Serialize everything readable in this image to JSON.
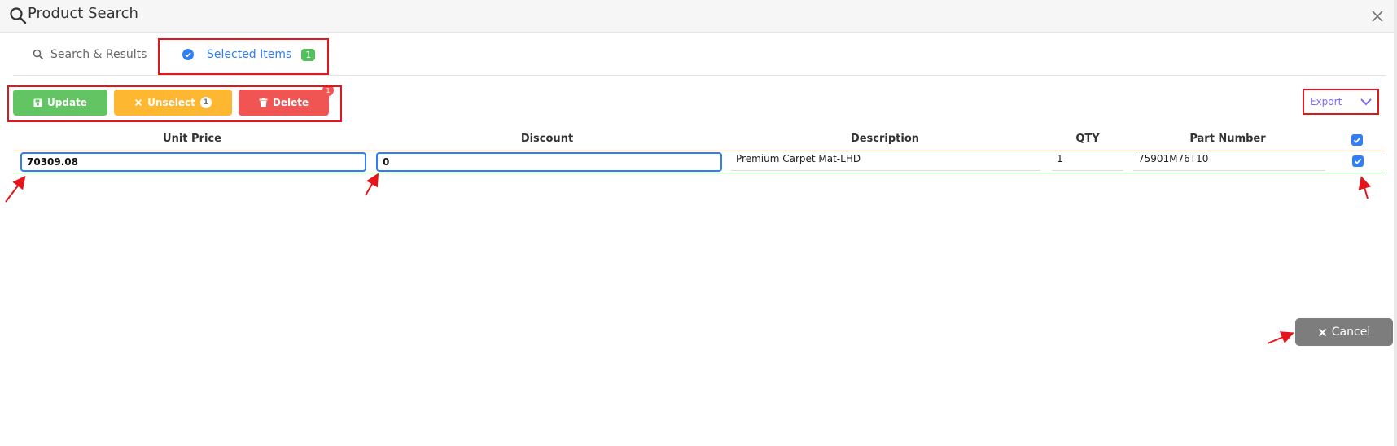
{
  "window": {
    "title": "Product Search"
  },
  "tabs": [
    {
      "label": "Search & Results",
      "icon": "search-icon"
    },
    {
      "label": "Selected Items",
      "icon": "check-circle-icon",
      "count": "1"
    }
  ],
  "toolbar": {
    "update_label": "Update",
    "unselect_label": "Unselect",
    "unselect_count": "1",
    "delete_label": "Delete",
    "delete_count": "1",
    "export_label": "Export"
  },
  "table": {
    "columns": [
      "Unit Price",
      "Discount",
      "Description",
      "QTY",
      "Part Number"
    ],
    "rows": [
      {
        "unit_price": "70309.08",
        "discount": "0",
        "description": "Premium Carpet Mat-LHD",
        "qty": "1",
        "part_number": "75901M76T10",
        "selected": true
      }
    ]
  },
  "footer": {
    "cancel_label": "Cancel"
  },
  "colors": {
    "accent": "#2f7ff8",
    "success": "#62c462",
    "warning": "#fdb731",
    "danger": "#f05553",
    "annotation": "#e4161c"
  }
}
